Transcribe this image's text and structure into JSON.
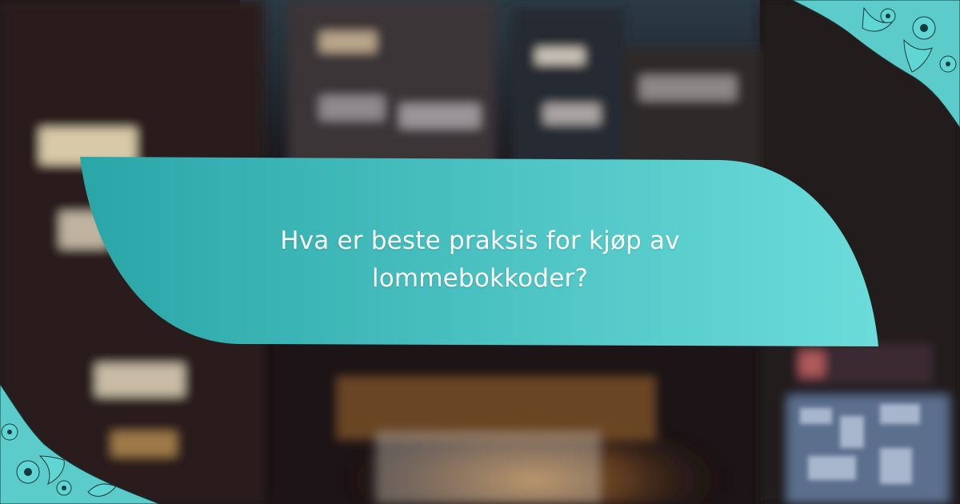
{
  "headline": {
    "text": "Hva er beste praksis for kjøp av lommebokkoder?"
  },
  "colors": {
    "banner_left": "#2aa6a8",
    "banner_right": "#6bdcda",
    "ornament": "#5fd6d4",
    "background_dark": "#1a1214"
  }
}
